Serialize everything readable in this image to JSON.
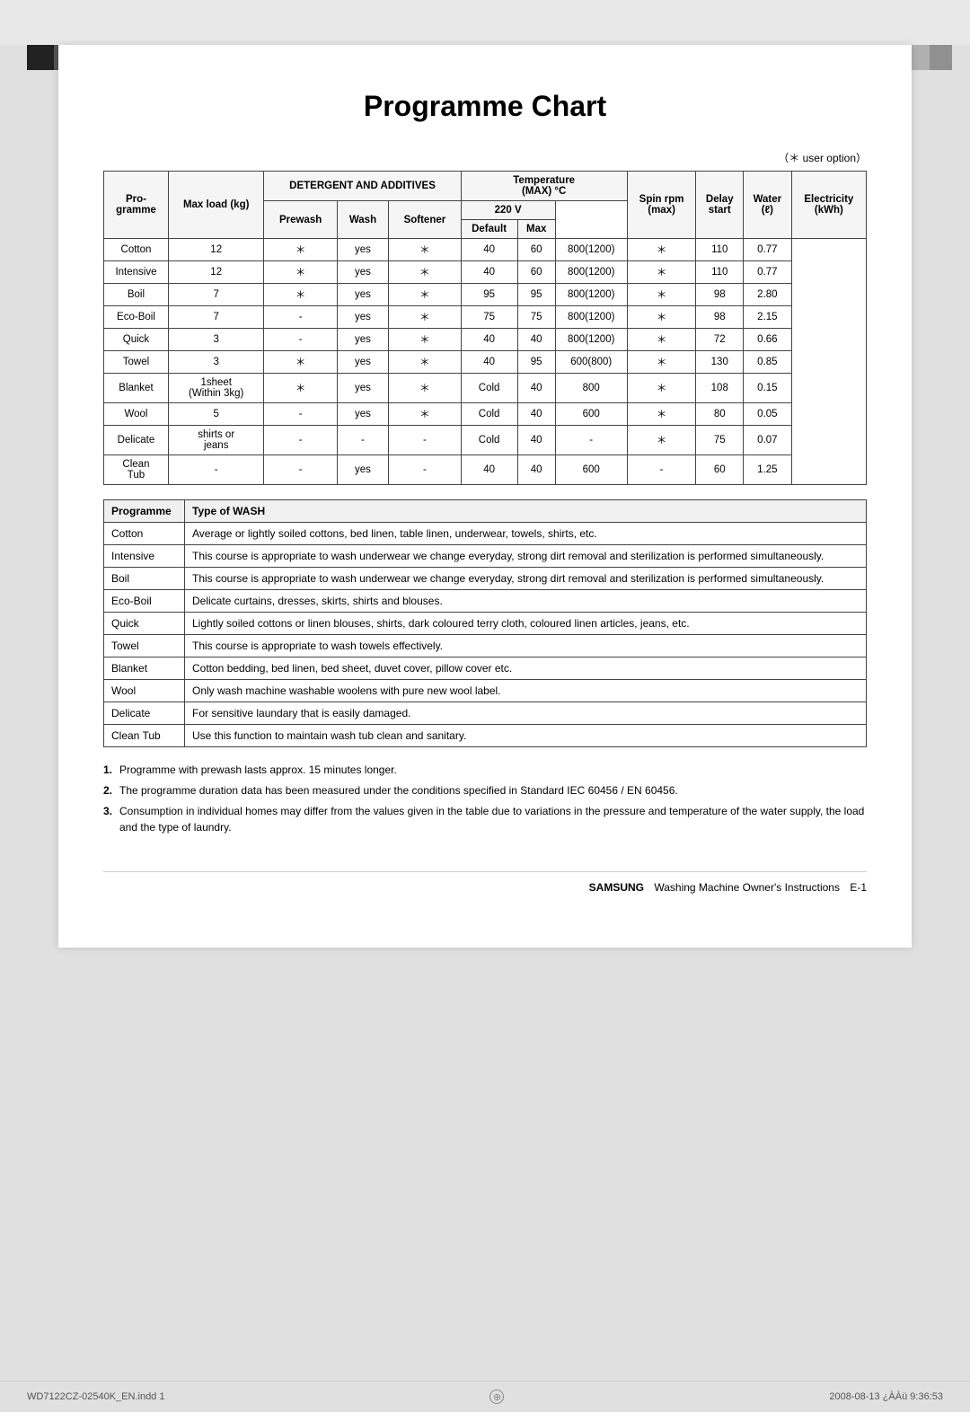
{
  "page": {
    "title": "Programme Chart",
    "user_option_note": "（＊ user option）",
    "header_cols": {
      "programme": "Pro-\ngramme",
      "max_load": "Max load (kg)",
      "detergent_group": "DETERGENT AND ADDITIVES",
      "prewash": "Prewash",
      "wash": "Wash",
      "softener": "Softener",
      "temperature_group": "Temperature\n(MAX) °C",
      "temp_220v": "220 V",
      "temp_default": "Default",
      "temp_max": "Max",
      "spin_rpm": "Spin rpm\n(max)",
      "delay_start": "Delay\nstart",
      "water": "Water\n(ℓ)",
      "electricity": "Electricity\n(kWh)"
    },
    "programmes": [
      {
        "name": "Cotton",
        "max_load": "12",
        "prewash": "＊",
        "wash": "yes",
        "softener": "＊",
        "temp_default": "40",
        "temp_max": "60",
        "spin_rpm": "800(1200)",
        "delay_start": "＊",
        "water": "110",
        "electricity": "0.77"
      },
      {
        "name": "Intensive",
        "max_load": "12",
        "prewash": "＊",
        "wash": "yes",
        "softener": "＊",
        "temp_default": "40",
        "temp_max": "60",
        "spin_rpm": "800(1200)",
        "delay_start": "＊",
        "water": "110",
        "electricity": "0.77"
      },
      {
        "name": "Boil",
        "max_load": "7",
        "prewash": "＊",
        "wash": "yes",
        "softener": "＊",
        "temp_default": "95",
        "temp_max": "95",
        "spin_rpm": "800(1200)",
        "delay_start": "＊",
        "water": "98",
        "electricity": "2.80"
      },
      {
        "name": "Eco-Boil",
        "max_load": "7",
        "prewash": "-",
        "wash": "yes",
        "softener": "＊",
        "temp_default": "75",
        "temp_max": "75",
        "spin_rpm": "800(1200)",
        "delay_start": "＊",
        "water": "98",
        "electricity": "2.15"
      },
      {
        "name": "Quick",
        "max_load": "3",
        "prewash": "-",
        "wash": "yes",
        "softener": "＊",
        "temp_default": "40",
        "temp_max": "40",
        "spin_rpm": "800(1200)",
        "delay_start": "＊",
        "water": "72",
        "electricity": "0.66"
      },
      {
        "name": "Towel",
        "max_load": "3",
        "prewash": "＊",
        "wash": "yes",
        "softener": "＊",
        "temp_default": "40",
        "temp_max": "95",
        "spin_rpm": "600(800)",
        "delay_start": "＊",
        "water": "130",
        "electricity": "0.85"
      },
      {
        "name": "Blanket",
        "max_load": "1sheet\n(Within 3kg)",
        "prewash": "＊",
        "wash": "yes",
        "softener": "＊",
        "temp_default": "Cold",
        "temp_max": "40",
        "spin_rpm": "800",
        "delay_start": "＊",
        "water": "108",
        "electricity": "0.15"
      },
      {
        "name": "Wool",
        "max_load": "5",
        "prewash": "-",
        "wash": "yes",
        "softener": "＊",
        "temp_default": "Cold",
        "temp_max": "40",
        "spin_rpm": "600",
        "delay_start": "＊",
        "water": "80",
        "electricity": "0.05"
      },
      {
        "name": "Delicate",
        "max_load": "shirts or\njeans",
        "prewash": "-",
        "wash": "-",
        "softener": "-",
        "temp_default": "Cold",
        "temp_max": "40",
        "spin_rpm": "-",
        "delay_start": "＊",
        "water": "75",
        "electricity": "0.07"
      },
      {
        "name": "Clean\nTub",
        "max_load": "-",
        "prewash": "-",
        "wash": "yes",
        "softener": "-",
        "temp_default": "40",
        "temp_max": "40",
        "spin_rpm": "600",
        "delay_start": "-",
        "water": "60",
        "electricity": "1.25"
      }
    ],
    "wash_types": {
      "header_programme": "Programme",
      "header_type": "Type of WASH",
      "rows": [
        {
          "name": "Cotton",
          "description": "Average or lightly soiled cottons, bed linen, table linen, underwear, towels, shirts, etc."
        },
        {
          "name": "Intensive",
          "description": "This course is appropriate to wash underwear we change everyday, strong dirt removal and sterilization is performed simultaneously."
        },
        {
          "name": "Boil",
          "description": "This course is appropriate to wash underwear we change everyday, strong dirt removal and sterilization is performed simultaneously."
        },
        {
          "name": "Eco-Boil",
          "description": "Delicate curtains, dresses, skirts, shirts and blouses."
        },
        {
          "name": "Quick",
          "description": "Lightly soiled cottons or linen blouses, shirts, dark coloured terry cloth, coloured linen articles, jeans, etc."
        },
        {
          "name": "Towel",
          "description": "This course is appropriate to wash towels effectively."
        },
        {
          "name": "Blanket",
          "description": "Cotton bedding, bed linen, bed sheet, duvet cover, pillow cover etc."
        },
        {
          "name": "Wool",
          "description": "Only wash machine washable woolens with pure new wool label."
        },
        {
          "name": "Delicate",
          "description": "For sensitive laundary that is easily damaged."
        },
        {
          "name": "Clean Tub",
          "description": "Use this function to maintain wash tub clean and sanitary."
        }
      ]
    },
    "notes": [
      "Programme with prewash lasts approx. 15 minutes longer.",
      "The programme duration data has been measured under the conditions specified in Standard IEC 60456 / EN 60456.",
      "Consumption in individual homes may differ from the values given in the table due to variations in the pressure and temperature of the water supply, the load and the type of laundry."
    ],
    "footer": {
      "brand": "SAMSUNG",
      "doc_title": "Washing Machine Owner's Instructions",
      "page": "E-1",
      "file_info": "WD7122CZ-02540K_EN.indd   1",
      "date_info": "2008-08-13   ¿ÀÀü 9:36:53"
    }
  }
}
